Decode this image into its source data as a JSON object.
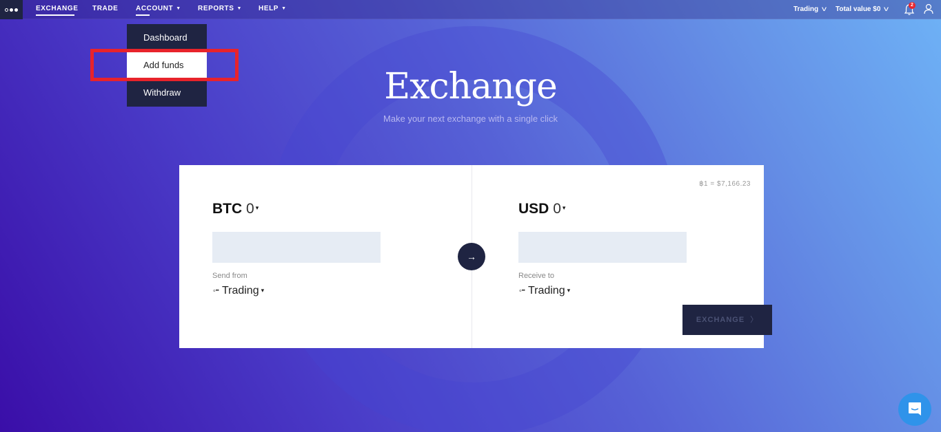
{
  "nav": {
    "menu_icon": "ellipsis-menu-icon",
    "items": [
      {
        "label": "EXCHANGE",
        "active": true,
        "has_caret": false
      },
      {
        "label": "TRADE",
        "active": false,
        "has_caret": false
      },
      {
        "label": "ACCOUNT",
        "active": false,
        "open": true,
        "has_caret": true
      },
      {
        "label": "REPORTS",
        "active": false,
        "has_caret": true
      },
      {
        "label": "HELP",
        "active": false,
        "has_caret": true
      }
    ],
    "caret": "▼",
    "right": {
      "account_selector": "Trading",
      "total_value": "Total value $0",
      "notification_count": "2",
      "chevron": "v"
    }
  },
  "account_dropdown": {
    "items": [
      {
        "label": "Dashboard",
        "highlighted": false
      },
      {
        "label": "Add funds",
        "highlighted": true
      },
      {
        "label": "Withdraw",
        "highlighted": false
      }
    ]
  },
  "hero": {
    "title": "Exchange",
    "subtitle": "Make your next exchange with a single click"
  },
  "exchange_card": {
    "rate": "฿1 = $7,166.23",
    "from": {
      "currency": "BTC",
      "balance": "0",
      "amount_value": "",
      "account_label": "Send from",
      "account": "Trading"
    },
    "to": {
      "currency": "USD",
      "balance": "0",
      "amount_value": "",
      "account_label": "Receive to",
      "account": "Trading"
    },
    "swap_icon": "→",
    "submit_label": "EXCHANGE",
    "submit_chevron": "〉",
    "caret": "▾",
    "dots": "∘••"
  },
  "colors": {
    "navy": "#1f2442",
    "highlight_red": "#e8232b",
    "badge_red": "#e8262d",
    "chat_blue": "#2f93ea"
  }
}
